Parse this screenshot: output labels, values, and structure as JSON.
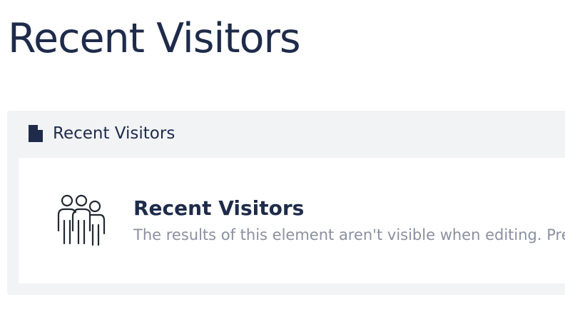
{
  "page": {
    "title": "Recent Visitors"
  },
  "panel": {
    "header_icon": "document-icon",
    "title": "Recent Visitors",
    "element": {
      "icon": "people-group-icon",
      "name": "Recent Visitors",
      "description": "The results of this element aren't visible when editing. Preview the page to see the results."
    }
  },
  "colors": {
    "heading": "#1e2b4a",
    "panel_bg": "#f2f3f5",
    "muted_text": "#8a90a0"
  }
}
